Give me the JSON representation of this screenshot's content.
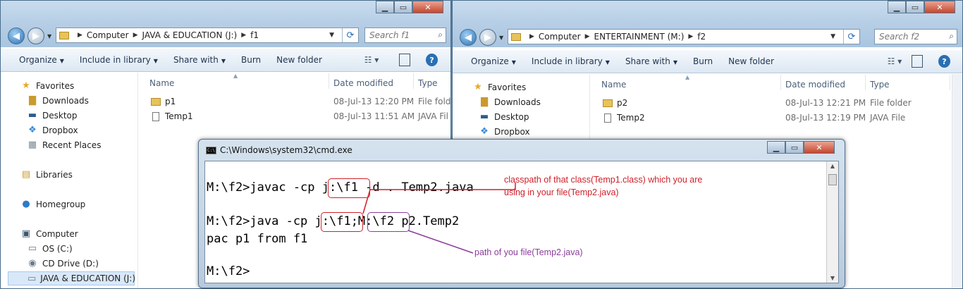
{
  "left_window": {
    "breadcrumb": [
      "Computer",
      "JAVA & EDUCATION (J:)",
      "f1"
    ],
    "search_placeholder": "Search f1",
    "toolbar": {
      "organize": "Organize",
      "include": "Include in library",
      "share": "Share with",
      "burn": "Burn",
      "new_folder": "New folder"
    },
    "nav": {
      "favorites": "Favorites",
      "downloads": "Downloads",
      "desktop": "Desktop",
      "dropbox": "Dropbox",
      "recent": "Recent Places",
      "libraries": "Libraries",
      "homegroup": "Homegroup",
      "computer": "Computer",
      "os": "OS (C:)",
      "cd": "CD Drive (D:)",
      "java": "JAVA & EDUCATION (J:)"
    },
    "columns": {
      "name": "Name",
      "date": "Date modified",
      "type": "Type"
    },
    "files": [
      {
        "name": "p1",
        "date": "08-Jul-13 12:20 PM",
        "type": "File fold"
      },
      {
        "name": "Temp1",
        "date": "08-Jul-13 11:51 AM",
        "type": "JAVA Fil"
      }
    ]
  },
  "right_window": {
    "breadcrumb": [
      "Computer",
      "ENTERTAINMENT (M:)",
      "f2"
    ],
    "search_placeholder": "Search f2",
    "toolbar": {
      "organize": "Organize",
      "include": "Include in library",
      "share": "Share with",
      "burn": "Burn",
      "new_folder": "New folder"
    },
    "nav": {
      "favorites": "Favorites",
      "downloads": "Downloads",
      "desktop": "Desktop",
      "dropbox": "Dropbox"
    },
    "columns": {
      "name": "Name",
      "date": "Date modified",
      "type": "Type",
      "size": "S"
    },
    "files": [
      {
        "name": "p2",
        "date": "08-Jul-13 12:21 PM",
        "type": "File folder"
      },
      {
        "name": "Temp2",
        "date": "08-Jul-13 12:19 PM",
        "type": "JAVA File"
      }
    ]
  },
  "cmd": {
    "title": "C:\\Windows\\system32\\cmd.exe",
    "lines": [
      "M:\\f2>javac -cp j:\\f1 -d . Temp2.java",
      "M:\\f2>java -cp j:\\f1;M:\\f2 p2.Temp2",
      "pac p1 from f1",
      "M:\\f2>"
    ]
  },
  "annotations": {
    "classpath_line1": "classpath of that class(Temp1.class) which you are",
    "classpath_line2": "using in your file(Temp2.java)",
    "path_note": "path of you file(Temp2.java)",
    "red_color": "#d0202a",
    "purple_color": "#8a3d9a"
  },
  "icons": [
    "back-arrow-icon",
    "forward-arrow-icon",
    "folder-icon",
    "refresh-icon",
    "search-icon",
    "view-icon",
    "preview-pane-icon",
    "help-icon",
    "star-icon",
    "download-folder-icon",
    "desktop-icon",
    "dropbox-icon",
    "recent-places-icon",
    "library-icon",
    "homegroup-icon",
    "computer-icon",
    "drive-icon",
    "cd-drive-icon",
    "file-icon",
    "cmd-icon"
  ]
}
